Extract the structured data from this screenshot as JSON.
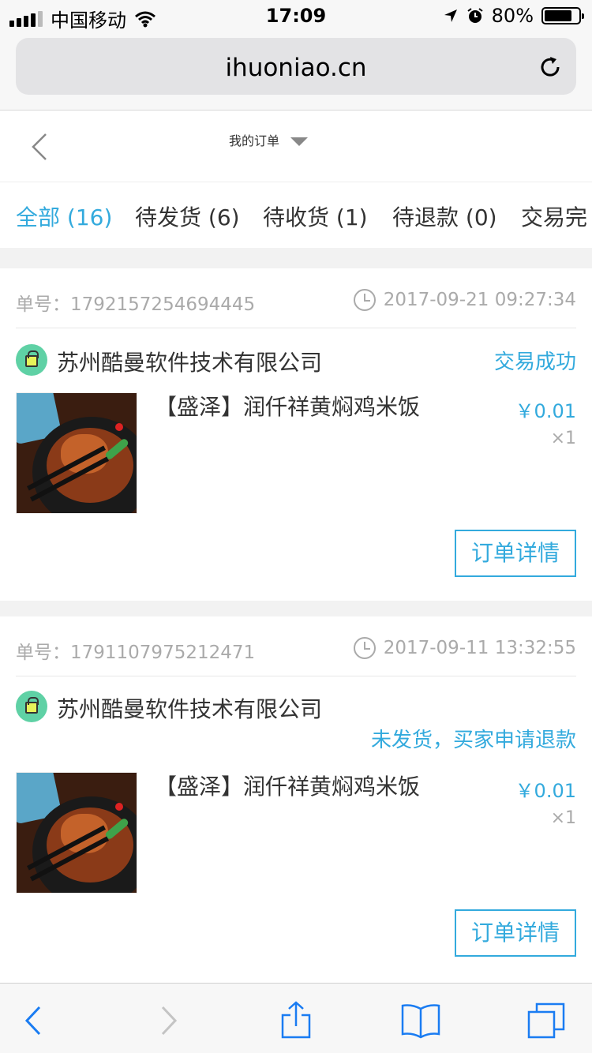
{
  "status_bar": {
    "carrier": "中国移动",
    "time": "17:09",
    "battery_text": "80%",
    "battery_level": 0.8
  },
  "browser": {
    "url": "ihuoniao.cn"
  },
  "header": {
    "title": "我的订单"
  },
  "tabs": [
    {
      "label": "全部 (16)",
      "active": true
    },
    {
      "label": "待发货 (6)",
      "active": false
    },
    {
      "label": "待收货 (1)",
      "active": false
    },
    {
      "label": "待退款 (0)",
      "active": false
    },
    {
      "label": "交易完",
      "active": false
    }
  ],
  "orders": [
    {
      "number_label": "单号：",
      "number": "1792157254694445",
      "datetime": "2017-09-21 09:27:34",
      "shop_name": "苏州酷曼软件技术有限公司",
      "status": "交易成功",
      "product_name": "【盛泽】润仟祥黄焖鸡米饭",
      "price": "￥0.01",
      "quantity": "×1",
      "detail_button": "订单详情"
    },
    {
      "number_label": "单号：",
      "number": "1791107975212471",
      "datetime": "2017-09-11 13:32:55",
      "shop_name": "苏州酷曼软件技术有限公司",
      "status": "未发货，买家申请退款",
      "product_name": "【盛泽】润仟祥黄焖鸡米饭",
      "price": "￥0.01",
      "quantity": "×1",
      "detail_button": "订单详情"
    }
  ],
  "colors": {
    "accent": "#33aadd",
    "ios_blue": "#1a7cf2"
  }
}
